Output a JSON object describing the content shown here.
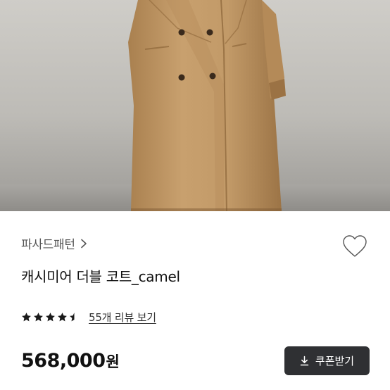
{
  "product": {
    "brand": "파사드패턴",
    "title": "캐시미어 더블 코트_camel",
    "rating": 4.5,
    "review_link": "55개 리뷰 보기",
    "price": "568,000",
    "price_unit": "원",
    "coupon_button": "쿠폰받기"
  },
  "icons": {
    "brand_chevron": "chevron-right-icon",
    "wishlist": "heart-outline-icon",
    "coupon": "download-icon",
    "star": "star-icon"
  },
  "colors": {
    "coat": "#c49d6c",
    "button_bg": "#2f3033",
    "star": "#1a1a1a"
  }
}
